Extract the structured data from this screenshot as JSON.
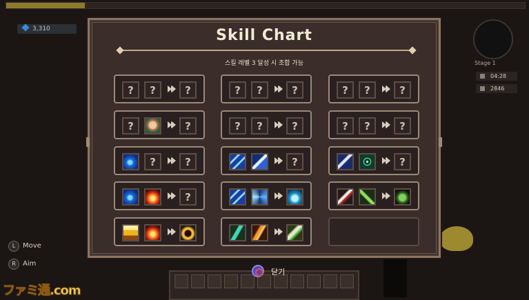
{
  "hud": {
    "gems": "3,310",
    "stage": "Stage 1",
    "timer": "04:28",
    "kills": "2846"
  },
  "controls": [
    {
      "button": "L",
      "label": "Move"
    },
    {
      "button": "R",
      "label": "Aim"
    }
  ],
  "watermark": "ファミ通.com",
  "dialog": {
    "title": "Skill Chart",
    "subtitle": "스킬 레벨 3 달성 시 조합 가능",
    "close_button": "O",
    "close_label": "닫기",
    "unknown_glyph": "?"
  },
  "recipes": [
    [
      "?",
      "?",
      "?"
    ],
    [
      "?",
      "?",
      "?"
    ],
    [
      "?",
      "?",
      "?"
    ],
    [
      "?",
      "ghost-icon",
      "?"
    ],
    [
      "?",
      "?",
      "?"
    ],
    [
      "?",
      "?",
      "?"
    ],
    [
      "wave-icon",
      "?",
      "?"
    ],
    [
      "ice-shards-icon",
      "ice-spear-icon",
      "?"
    ],
    [
      "blade-icon",
      "target-icon",
      "?"
    ],
    [
      "wave-icon",
      "fire-icon",
      "?"
    ],
    [
      "ice-shards-icon",
      "swirl-icon",
      "crystal-icon"
    ],
    [
      "slash-icon",
      "arrows-icon",
      "goblin-icon"
    ],
    [
      "yellow-icon",
      "fire-icon",
      "bomb-icon"
    ],
    [
      "dash-icon",
      "fire-streak-icon",
      "sword-icon"
    ],
    null
  ]
}
